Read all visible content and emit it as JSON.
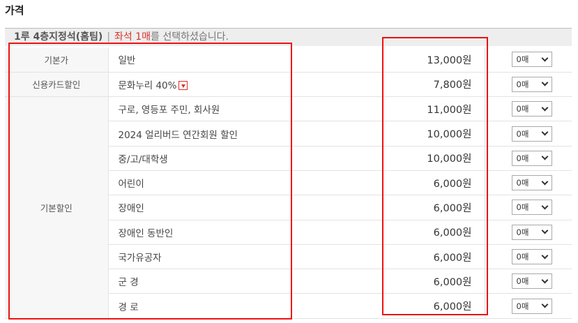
{
  "section_title": "가격",
  "header": {
    "seat": "1루 4층지정석(홈팀)",
    "separator": "|",
    "selection": "좌석 1매",
    "message": "를 선택하셨습니다."
  },
  "rows": [
    {
      "category": "기본가",
      "name": "일반",
      "price": "13,000원",
      "qty": "0매",
      "dropdown": false
    },
    {
      "category": "신용카드할인",
      "name": "문화누리 40%",
      "price": "7,800원",
      "qty": "0매",
      "dropdown": true
    },
    {
      "category": "기본할인",
      "name": "구로, 영등포 주민, 회사원",
      "price": "11,000원",
      "qty": "0매",
      "dropdown": false
    },
    {
      "name": "2024 얼리버드 연간회원 할인",
      "price": "10,000원",
      "qty": "0매",
      "dropdown": false
    },
    {
      "name": "중/고/대학생",
      "price": "10,000원",
      "qty": "0매",
      "dropdown": false
    },
    {
      "name": "어린이",
      "price": "6,000원",
      "qty": "0매",
      "dropdown": false
    },
    {
      "name": "장애인",
      "price": "6,000원",
      "qty": "0매",
      "dropdown": false
    },
    {
      "name": "장애인 동반인",
      "price": "6,000원",
      "qty": "0매",
      "dropdown": false
    },
    {
      "name": "국가유공자",
      "price": "6,000원",
      "qty": "0매",
      "dropdown": false
    },
    {
      "name": "군 경",
      "price": "6,000원",
      "qty": "0매",
      "dropdown": false
    },
    {
      "name": "경 로",
      "price": "6,000원",
      "qty": "0매",
      "dropdown": false
    }
  ],
  "colors": {
    "highlight": "#ee1111",
    "accent": "#d9302b",
    "header_bg": "#eeeeee",
    "category_bg": "#f7f7f7"
  },
  "icons": {
    "dropdown": "chevron-down-icon",
    "discount_info": "caret-down-box-icon"
  }
}
